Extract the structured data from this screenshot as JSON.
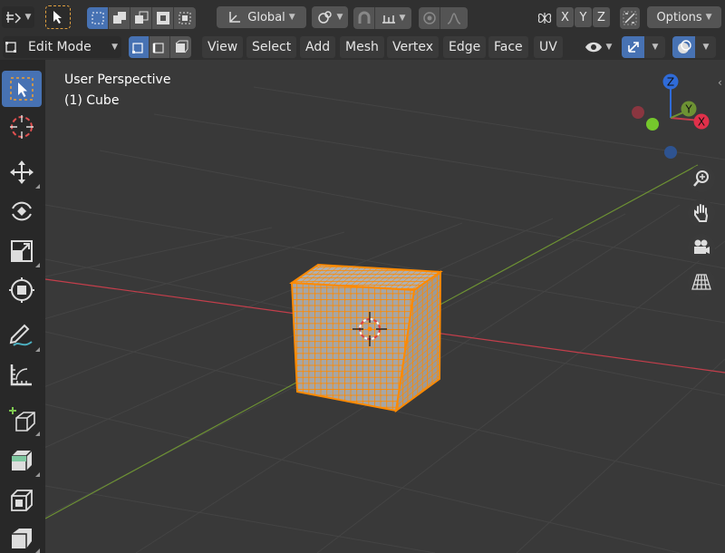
{
  "header": {
    "orientation": "Global",
    "options_label": "Options",
    "axes": [
      "X",
      "Y",
      "Z"
    ]
  },
  "mode_bar": {
    "mode": "Edit Mode",
    "menus": [
      "View",
      "Select",
      "Add",
      "Mesh",
      "Vertex",
      "Edge",
      "Face",
      "UV"
    ]
  },
  "viewport": {
    "view_name": "User Perspective",
    "object_label": "(1) Cube",
    "gizmo": {
      "x": "X",
      "y": "Y",
      "z": "Z"
    }
  },
  "tools": [
    "select-box-tool",
    "cursor-tool",
    "move-tool",
    "rotate-tool",
    "scale-tool",
    "transform-tool",
    "annotate-tool",
    "measure-tool",
    "add-cube-tool",
    "extrude-region-tool",
    "inset-faces-tool",
    "bevel-tool"
  ],
  "colors": {
    "accent": "#4772b3",
    "selection": "#ff8a00",
    "x_axis": "#c33e4b",
    "y_axis": "#6d9233",
    "z_axis": "#2f6bd8"
  }
}
